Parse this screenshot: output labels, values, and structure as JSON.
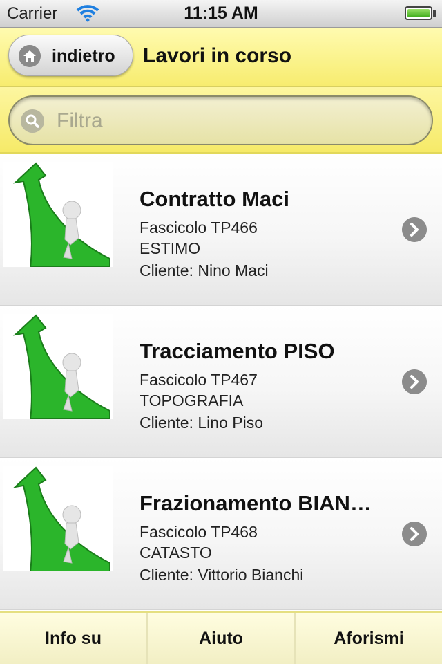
{
  "status_bar": {
    "carrier": "Carrier",
    "time": "11:15 AM",
    "icons": [
      "wifi-icon",
      "battery-icon"
    ]
  },
  "header": {
    "back_label": "indietro",
    "back_icon": "home-icon",
    "title": "Lavori in corso",
    "accent_color": "#f7ec6e"
  },
  "search": {
    "placeholder": "Filtra",
    "icon": "search-icon"
  },
  "list": {
    "items": [
      {
        "title": "Contratto Maci",
        "fascicolo": "Fascicolo TP466",
        "category": "ESTIMO",
        "client": "Cliente: Nino Maci",
        "icon": "chevron-right-icon"
      },
      {
        "title": "Tracciamento PISO",
        "fascicolo": "Fascicolo TP467",
        "category": "TOPOGRAFIA",
        "client": "Cliente: Lino Piso",
        "icon": "chevron-right-icon"
      },
      {
        "title": "Frazionamento BIAN…",
        "fascicolo": "Fascicolo TP468",
        "category": "CATASTO",
        "client": "Cliente: Vittorio Bianchi",
        "icon": "chevron-right-icon"
      }
    ]
  },
  "tab_bar": {
    "tabs": [
      {
        "label": "Info su"
      },
      {
        "label": "Aiuto"
      },
      {
        "label": "Aforismi"
      }
    ]
  }
}
